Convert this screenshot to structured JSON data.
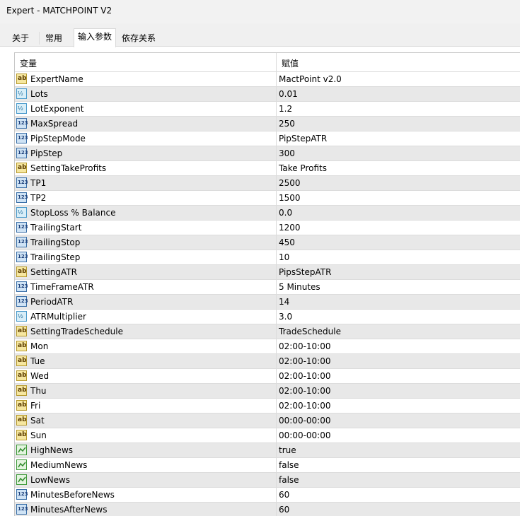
{
  "window": {
    "title": "Expert - MATCHPOINT V2"
  },
  "tabs": [
    {
      "label": "关于"
    },
    {
      "label": "常用"
    },
    {
      "label": "输入参数"
    },
    {
      "label": "依存关系"
    }
  ],
  "table": {
    "headers": {
      "variable": "变量",
      "value": "赋值"
    },
    "rows": [
      {
        "icon": "string-type-icon",
        "icon_text": "ab",
        "name": "ExpertName",
        "value": "MactPoint v2.0"
      },
      {
        "icon": "double-type-icon",
        "icon_text": "½",
        "name": "Lots",
        "value": "0.01"
      },
      {
        "icon": "double-type-icon",
        "icon_text": "½",
        "name": "LotExponent",
        "value": "1.2"
      },
      {
        "icon": "integer-type-icon",
        "icon_text": "123",
        "name": "MaxSpread",
        "value": "250"
      },
      {
        "icon": "integer-type-icon",
        "icon_text": "123",
        "name": "PipStepMode",
        "value": "PipStepATR"
      },
      {
        "icon": "integer-type-icon",
        "icon_text": "123",
        "name": "PipStep",
        "value": "300"
      },
      {
        "icon": "string-type-icon",
        "icon_text": "ab",
        "name": "SettingTakeProfits",
        "value": "Take Profits"
      },
      {
        "icon": "integer-type-icon",
        "icon_text": "123",
        "name": "TP1",
        "value": "2500"
      },
      {
        "icon": "integer-type-icon",
        "icon_text": "123",
        "name": "TP2",
        "value": "1500"
      },
      {
        "icon": "double-type-icon",
        "icon_text": "½",
        "name": "StopLoss % Balance",
        "value": "0.0"
      },
      {
        "icon": "integer-type-icon",
        "icon_text": "123",
        "name": "TrailingStart",
        "value": "1200"
      },
      {
        "icon": "integer-type-icon",
        "icon_text": "123",
        "name": "TrailingStop",
        "value": "450"
      },
      {
        "icon": "integer-type-icon",
        "icon_text": "123",
        "name": "TrailingStep",
        "value": "10"
      },
      {
        "icon": "string-type-icon",
        "icon_text": "ab",
        "name": "SettingATR",
        "value": "PipsStepATR"
      },
      {
        "icon": "integer-type-icon",
        "icon_text": "123",
        "name": "TimeFrameATR",
        "value": "5 Minutes"
      },
      {
        "icon": "integer-type-icon",
        "icon_text": "123",
        "name": "PeriodATR",
        "value": "14"
      },
      {
        "icon": "double-type-icon",
        "icon_text": "½",
        "name": "ATRMultiplier",
        "value": "3.0"
      },
      {
        "icon": "string-type-icon",
        "icon_text": "ab",
        "name": "SettingTradeSchedule",
        "value": "TradeSchedule"
      },
      {
        "icon": "string-type-icon",
        "icon_text": "ab",
        "name": "Mon",
        "value": "02:00-10:00"
      },
      {
        "icon": "string-type-icon",
        "icon_text": "ab",
        "name": "Tue",
        "value": "02:00-10:00"
      },
      {
        "icon": "string-type-icon",
        "icon_text": "ab",
        "name": "Wed",
        "value": "02:00-10:00"
      },
      {
        "icon": "string-type-icon",
        "icon_text": "ab",
        "name": "Thu",
        "value": "02:00-10:00"
      },
      {
        "icon": "string-type-icon",
        "icon_text": "ab",
        "name": "Fri",
        "value": "02:00-10:00"
      },
      {
        "icon": "string-type-icon",
        "icon_text": "ab",
        "name": "Sat",
        "value": "00:00-00:00"
      },
      {
        "icon": "string-type-icon",
        "icon_text": "ab",
        "name": "Sun",
        "value": "00:00-00:00"
      },
      {
        "icon": "boolean-type-icon",
        "icon_text": "",
        "name": "HighNews",
        "value": "true"
      },
      {
        "icon": "boolean-type-icon",
        "icon_text": "",
        "name": "MediumNews",
        "value": "false"
      },
      {
        "icon": "boolean-type-icon",
        "icon_text": "",
        "name": "LowNews",
        "value": "false"
      },
      {
        "icon": "integer-type-icon",
        "icon_text": "123",
        "name": "MinutesBeforeNews",
        "value": "60"
      },
      {
        "icon": "integer-type-icon",
        "icon_text": "123",
        "name": "MinutesAfterNews",
        "value": "60"
      }
    ]
  }
}
